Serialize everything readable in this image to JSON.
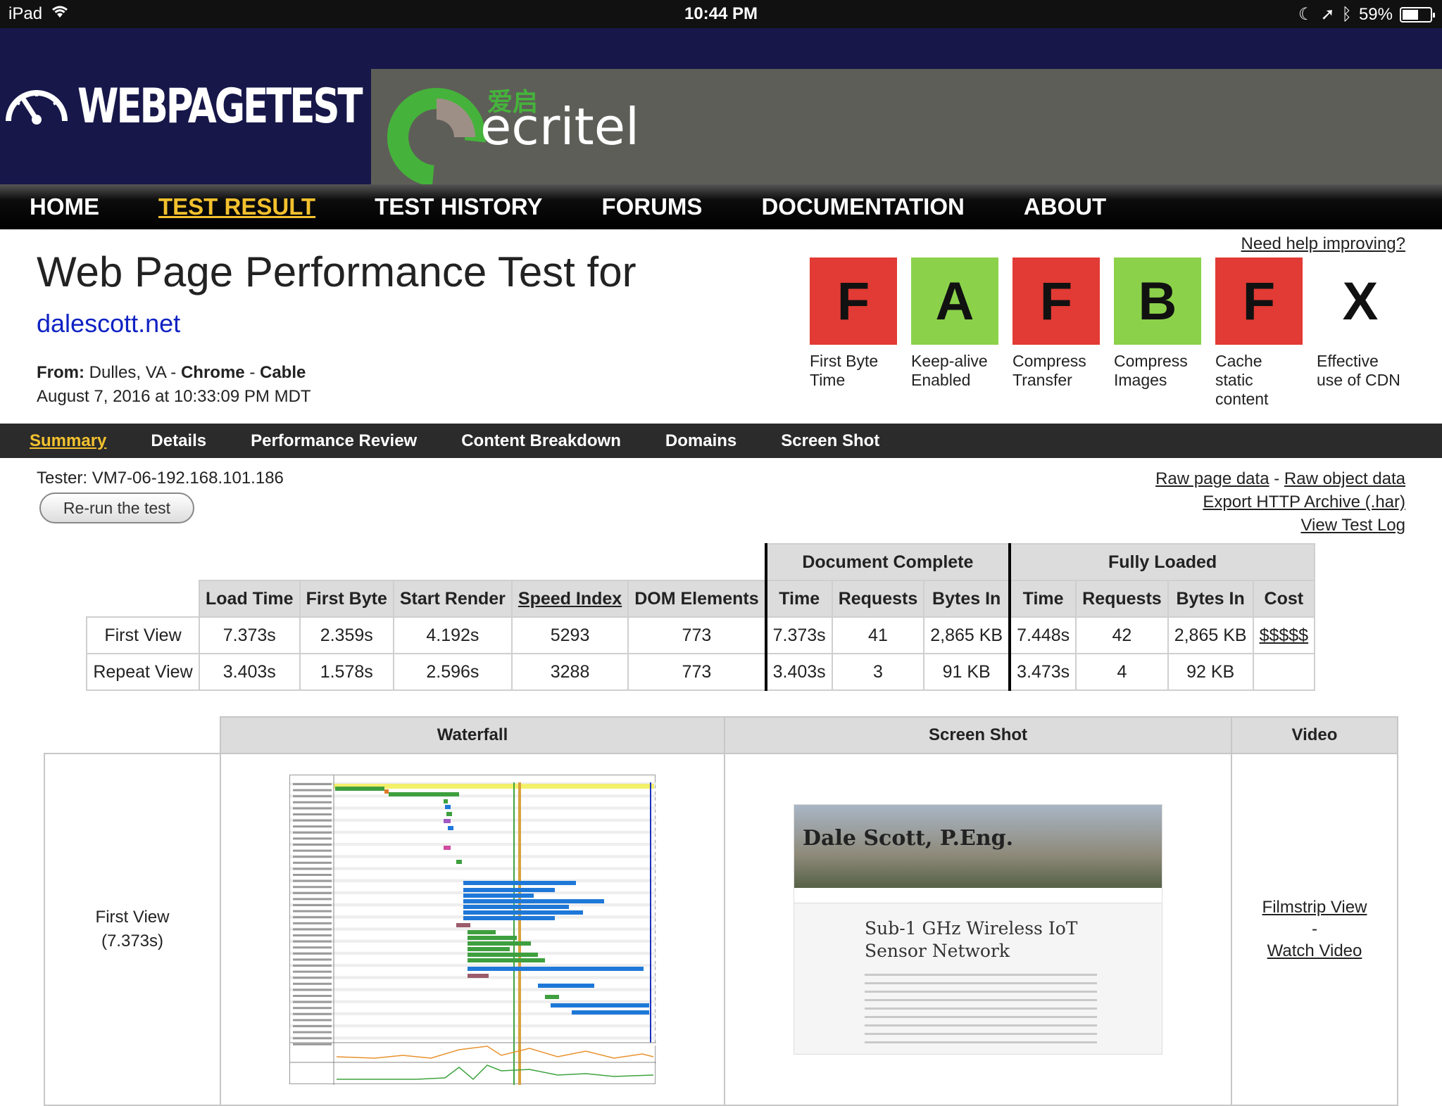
{
  "status_bar": {
    "device": "iPad",
    "time": "10:44 PM",
    "battery": "59%",
    "battery_level": 0.59
  },
  "header": {
    "logo_text": "WEBPAGETEST",
    "ad_brand": "ecritel",
    "ad_brand_cn": "爱启"
  },
  "main_nav": [
    "HOME",
    "TEST RESULT",
    "TEST HISTORY",
    "FORUMS",
    "DOCUMENTATION",
    "ABOUT"
  ],
  "main_nav_active": "TEST RESULT",
  "title": "Web Page Performance Test for",
  "url": "dalescott.net",
  "from": {
    "label": "From:",
    "location": "Dulles, VA -",
    "browser": "Chrome",
    "sep": "-",
    "connection": "Cable"
  },
  "date": "August 7, 2016 at 10:33:09 PM MDT",
  "help_link": "Need help improving?",
  "grades": [
    {
      "letter": "F",
      "label": "First Byte Time",
      "color": "#e23a34"
    },
    {
      "letter": "A",
      "label": "Keep-alive Enabled",
      "color": "#8bd24a"
    },
    {
      "letter": "F",
      "label": "Compress Transfer",
      "color": "#e23a34"
    },
    {
      "letter": "B",
      "label": "Compress Images",
      "color": "#8bd24a"
    },
    {
      "letter": "F",
      "label": "Cache static content",
      "color": "#e23a34"
    },
    {
      "letter": "X",
      "label": "Effective use of CDN",
      "color": "none"
    }
  ],
  "sub_nav": [
    "Summary",
    "Details",
    "Performance Review",
    "Content Breakdown",
    "Domains",
    "Screen Shot"
  ],
  "tester": "Tester: VM7-06-192.168.101.186",
  "rerun": "Re-run the test",
  "raw_links": {
    "raw_page": "Raw page data",
    "sep": "-",
    "raw_object": "Raw object data",
    "har": "Export HTTP Archive (.har)",
    "log": "View Test Log"
  },
  "results": {
    "group_headers": [
      "Document Complete",
      "Fully Loaded"
    ],
    "columns": [
      "Load Time",
      "First Byte",
      "Start Render",
      "Speed Index",
      "DOM Elements",
      "Time",
      "Requests",
      "Bytes In",
      "Time",
      "Requests",
      "Bytes In",
      "Cost"
    ],
    "rows": [
      {
        "label": "First View",
        "values": [
          "7.373s",
          "2.359s",
          "4.192s",
          "5293",
          "773",
          "7.373s",
          "41",
          "2,865 KB",
          "7.448s",
          "42",
          "2,865 KB",
          "$$$$$"
        ]
      },
      {
        "label": "Repeat View",
        "values": [
          "3.403s",
          "1.578s",
          "2.596s",
          "3288",
          "773",
          "3.403s",
          "3",
          "91 KB",
          "3.473s",
          "4",
          "92 KB",
          ""
        ]
      }
    ]
  },
  "panel": {
    "headers": [
      "Waterfall",
      "Screen Shot",
      "Video"
    ],
    "row_label": "First View",
    "row_time": "(7.373s)",
    "screenshot_site": "Dale Scott, P.Eng.",
    "screenshot_post_1": "Sub-1 GHz Wireless IoT",
    "screenshot_post_2": "Sensor Network",
    "video_links": [
      "Filmstrip View",
      "-",
      "Watch Video"
    ]
  }
}
